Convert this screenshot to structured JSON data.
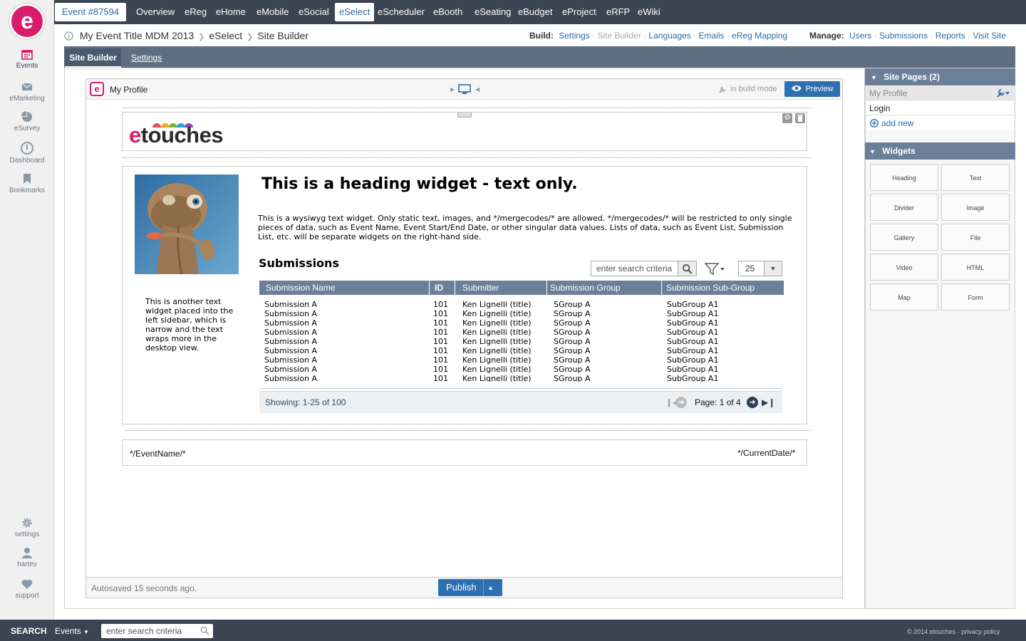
{
  "rail": {
    "items": [
      {
        "label": "Events",
        "icon": "calendar-icon"
      },
      {
        "label": "eMarketing",
        "icon": "envelope-icon"
      },
      {
        "label": "eSurvey",
        "icon": "pie-chart-icon"
      },
      {
        "label": "Dashboard",
        "icon": "dashboard-gauge-icon"
      },
      {
        "label": "Bookmarks",
        "icon": "bookmark-icon"
      }
    ],
    "bottom": [
      {
        "label": "settings",
        "icon": "gear-icon"
      },
      {
        "label": "hartev",
        "icon": "user-icon"
      },
      {
        "label": "support",
        "icon": "heart-icon"
      }
    ],
    "logo": "e"
  },
  "topnav": {
    "event": "Event #87594",
    "items": [
      "Overview",
      "eReg",
      "eHome",
      "eMobile",
      "eSocial",
      "eSelect",
      "eScheduler",
      "eBooth",
      "eSeating",
      "eBudget",
      "eProject",
      "eRFP",
      "eWiki"
    ],
    "selected": "eSelect"
  },
  "breadcrumb": {
    "title": "My Event Title MDM 2013",
    "module": "eSelect",
    "page": "Site Builder"
  },
  "build": {
    "label": "Build:",
    "links": [
      "Settings",
      "Site Builder",
      "Languages",
      "Emails",
      "eReg Mapping"
    ],
    "manage_label": "Manage:",
    "manage_links": [
      "Users",
      "Submissions",
      "Reports",
      "Visit Site"
    ]
  },
  "tabs": {
    "active": "Site Builder",
    "other": "Settings"
  },
  "canvas": {
    "page_name": "My Profile",
    "logo": "e",
    "build_mode": "in build mode",
    "preview": "Preview"
  },
  "header_widget": {
    "brand": "etouches"
  },
  "heading_widget": "This is a heading widget - text only.",
  "text_widget": "This is a wysiwyg text widget.  Only static text, images, and */mergecodes/* are allowed.  */mergecodes/* will be restricted to only single pieces of data, such as Event Name, Event Start/End Date, or other singular data values.  Lists of data, such as Event List, Submission List, etc. will be separate widgets on the right-hand side.",
  "sidebar_text": "This is another text widget placed into the left sidebar, which is narrow and the text wraps more in the desktop view.",
  "submissions": {
    "title": "Submissions",
    "search_placeholder": "enter search criteria",
    "page_size": "25",
    "columns": [
      "Submission Name",
      "ID",
      "Submitter",
      "Submission Group",
      "Submission Sub-Group"
    ],
    "rows": [
      [
        "Submission A",
        "101",
        "Ken Lignelli (title)",
        "SGroup A",
        "SubGroup A1"
      ],
      [
        "Submission A",
        "101",
        "Ken Lignelli (title)",
        "SGroup A",
        "SubGroup A1"
      ],
      [
        "Submission A",
        "101",
        "Ken Lignelli (title)",
        "SGroup A",
        "SubGroup A1"
      ],
      [
        "Submission A",
        "101",
        "Ken Lignelli (title)",
        "SGroup A",
        "SubGroup A1"
      ],
      [
        "Submission A",
        "101",
        "Ken Lignelli (title)",
        "SGroup A",
        "SubGroup A1"
      ],
      [
        "Submission A",
        "101",
        "Ken Lignelli (title)",
        "SGroup A",
        "SubGroup A1"
      ],
      [
        "Submission A",
        "101",
        "Ken Lignelli (title)",
        "SGroup A",
        "SubGroup A1"
      ],
      [
        "Submission A",
        "101",
        "Ken Lignelli (title)",
        "SGroup A",
        "SubGroup A1"
      ],
      [
        "Submission A",
        "101",
        "Ken Lignelli (title)",
        "SGroup A",
        "SubGroup A1"
      ]
    ],
    "showing": "Showing: 1-25 of 100",
    "page": "Page: 1 of 4"
  },
  "footer_widget": {
    "left": "*/EventName/*",
    "right": "*/CurrentDate/*"
  },
  "autosave": "Autosaved 15 seconds ago.",
  "publish": "Publish",
  "site_pages": {
    "title": "Site Pages (2)",
    "pages": [
      "My Profile",
      "Login"
    ],
    "add_new": "add new"
  },
  "widgets": {
    "title": "Widgets",
    "items": [
      "Heading",
      "Text",
      "Divider",
      "Image",
      "Gallery",
      "File",
      "Video",
      "HTML",
      "Map",
      "Form"
    ]
  },
  "bottombar": {
    "search_label": "SEARCH",
    "scope": "Events",
    "placeholder": "enter search criteria",
    "copyright": "© 2014 etouches",
    "privacy": "privacy policy"
  },
  "colors": {
    "brand": "#d81b6a",
    "nav_bg": "#3a4452",
    "accent": "#2e6fb0",
    "table_header": "#6b7f98"
  }
}
